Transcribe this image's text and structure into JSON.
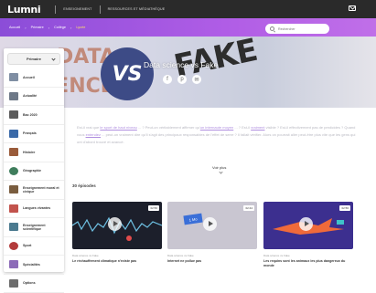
{
  "topbar": {
    "logo": "Lumni",
    "links": [
      "ENSEIGNEMENT",
      "RESSOURCES ET MÉDIATHÈQUE"
    ]
  },
  "breadcrumb": [
    "Accueil",
    "Primaire",
    "Collège",
    "Lycée"
  ],
  "search": {
    "placeholder": "Rechercher"
  },
  "hero": {
    "bg_left_text": "DATA\nIENCE",
    "circle_text": "VS",
    "title": "Data science vs Fake",
    "fake_text": "FAKE",
    "share_icons": [
      "facebook-icon",
      "pinterest-icon",
      "mail-icon"
    ]
  },
  "sidebar": {
    "grade": "Primaire",
    "items": [
      {
        "label": "Accueil",
        "icon": "house-icon"
      },
      {
        "label": "Actualité",
        "icon": "newspaper-icon"
      },
      {
        "label": "Bac 2020",
        "icon": "diploma-icon"
      },
      {
        "label": "Français",
        "icon": "book-icon"
      },
      {
        "label": "Histoire",
        "icon": "scroll-icon"
      },
      {
        "label": "Géographie",
        "icon": "globe-icon"
      },
      {
        "label": "Enseignement moral et civique",
        "icon": "scales-icon"
      },
      {
        "label": "Langues vivantes",
        "icon": "speech-icon"
      },
      {
        "label": "Enseignement scientifique",
        "icon": "flask-icon"
      },
      {
        "label": "Sport",
        "icon": "ball-icon"
      },
      {
        "label": "Spécialités",
        "icon": "star-icon"
      },
      {
        "label": "Options",
        "icon": "list-icon"
      }
    ]
  },
  "description": {
    "text_parts": [
      "Est-il vrai que ",
      "le sport de haut niveau",
      " ... ? Peut-on véritablement affirmer qu'",
      "un internaute moyen",
      " ... ? Est-il ",
      "vraiment",
      " visible ? Est-il effectivement pas de pesticides ? Quand vous ",
      "entendez",
      " ... peut-on vraiment dire qu'il s'agit des principaux responsables de l'effet de serre ? Il fallait vérifier. Alors on pourrait aller peut-être plus vite que les gens qui ont d'abord trouvé et avancé."
    ],
    "more_label": "Voir plus"
  },
  "episodes": {
    "count_label": "30 épisodes",
    "cards": [
      {
        "duration": "02:56",
        "series": "Data science vs Fake",
        "title": "Le réchauffement climatique n'existe pas",
        "thumb_bg": "#1c1f2b"
      },
      {
        "duration": "02:44",
        "series": "Data science vs Fake",
        "title": "Internet ne pollue pas",
        "thumb_bg": "#c9c6d1"
      },
      {
        "duration": "02:56",
        "series": "Data science vs Fake",
        "title": "Les requins sont les animaux les plus dangereux du monde",
        "thumb_bg": "#3c2f8f"
      }
    ]
  }
}
